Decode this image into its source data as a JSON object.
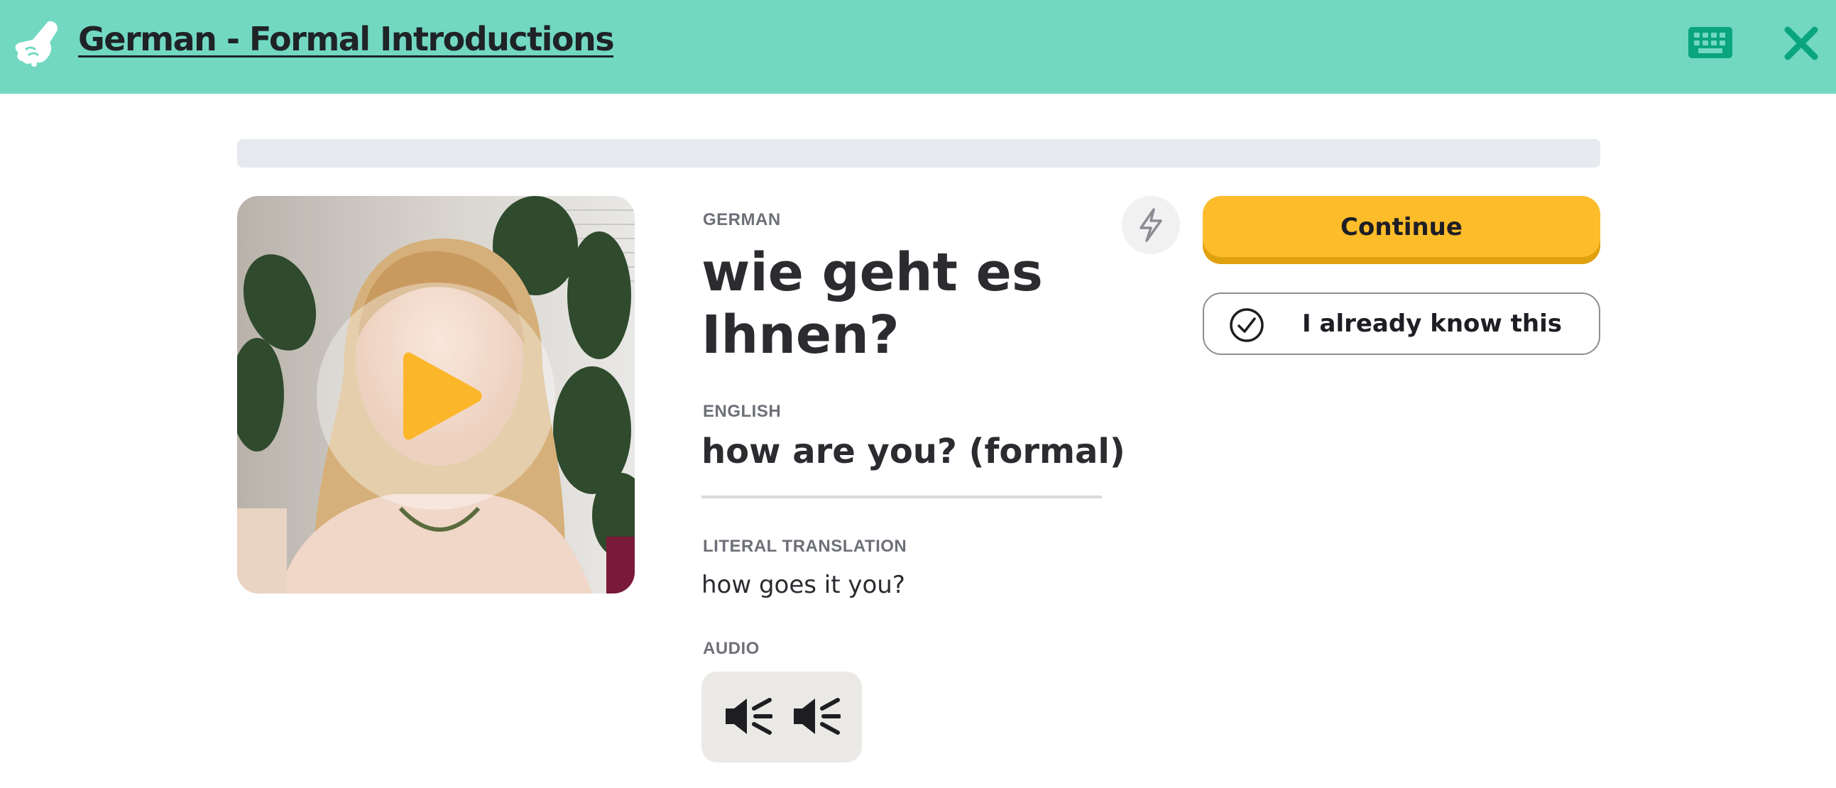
{
  "header": {
    "title": "German - Formal Introductions",
    "logo_icon": "hand-pointing-icon",
    "keyboard_icon": "keyboard-icon",
    "close_icon": "close-x-icon"
  },
  "progress": {
    "value": 0.0
  },
  "card": {
    "video": {
      "play_icon": "play-icon"
    },
    "german_label": "GERMAN",
    "german_text": "wie geht es Ihnen?",
    "english_label": "ENGLISH",
    "english_text": "how are you? (formal)",
    "literal_label": "LITERAL TRANSLATION",
    "literal_text": "how goes it you?",
    "audio_label": "AUDIO",
    "audio_buttons": [
      {
        "icon": "speaker-icon"
      },
      {
        "icon": "speaker-icon"
      }
    ]
  },
  "actions": {
    "bolt_icon": "lightning-bolt-icon",
    "continue_label": "Continue",
    "know_label": "I already know this",
    "know_icon": "check-circle-icon"
  },
  "colors": {
    "header_bg": "#72d8c2",
    "accent_green": "#0aa57e",
    "continue_bg": "#fdbc2a",
    "play_color": "#fcb62a",
    "progress_track": "#e6e9ee"
  }
}
